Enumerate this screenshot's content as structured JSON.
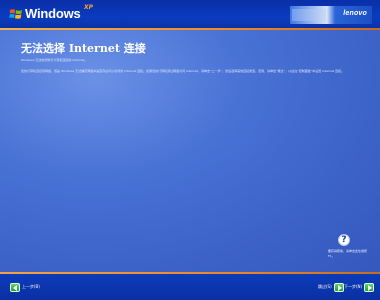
{
  "header": {
    "windows_wordmark": "Windows",
    "windows_version": "XP",
    "brand": "lenovo"
  },
  "main": {
    "title": "无法选择 Internet 连接",
    "subtitle": "Windows 无法检测到与计算机连接的 Internet。",
    "description": "您的计算机连接到网络，但是 Windows 无法确定网络中是否存在可以访问的 Internet 连接。如果您的计算机通过网络访问 Internet，请单击“上一步”，然后选择其他连接类型。否则，请单击“跳过”，以后在“控制面板”中设置 Internet 连接。"
  },
  "help": {
    "icon": "question-mark-icon",
    "text": "要获得帮助，请单击此处或按 F1。"
  },
  "footer": {
    "back_label": "上一步(B)",
    "skip_label": "跳过(S)",
    "next_label": "下一步(N)"
  },
  "colors": {
    "background": "#3b63c9",
    "header": "#0b3bc0",
    "accent_line": "#f08a24",
    "nav_button": "#1e9b32"
  }
}
